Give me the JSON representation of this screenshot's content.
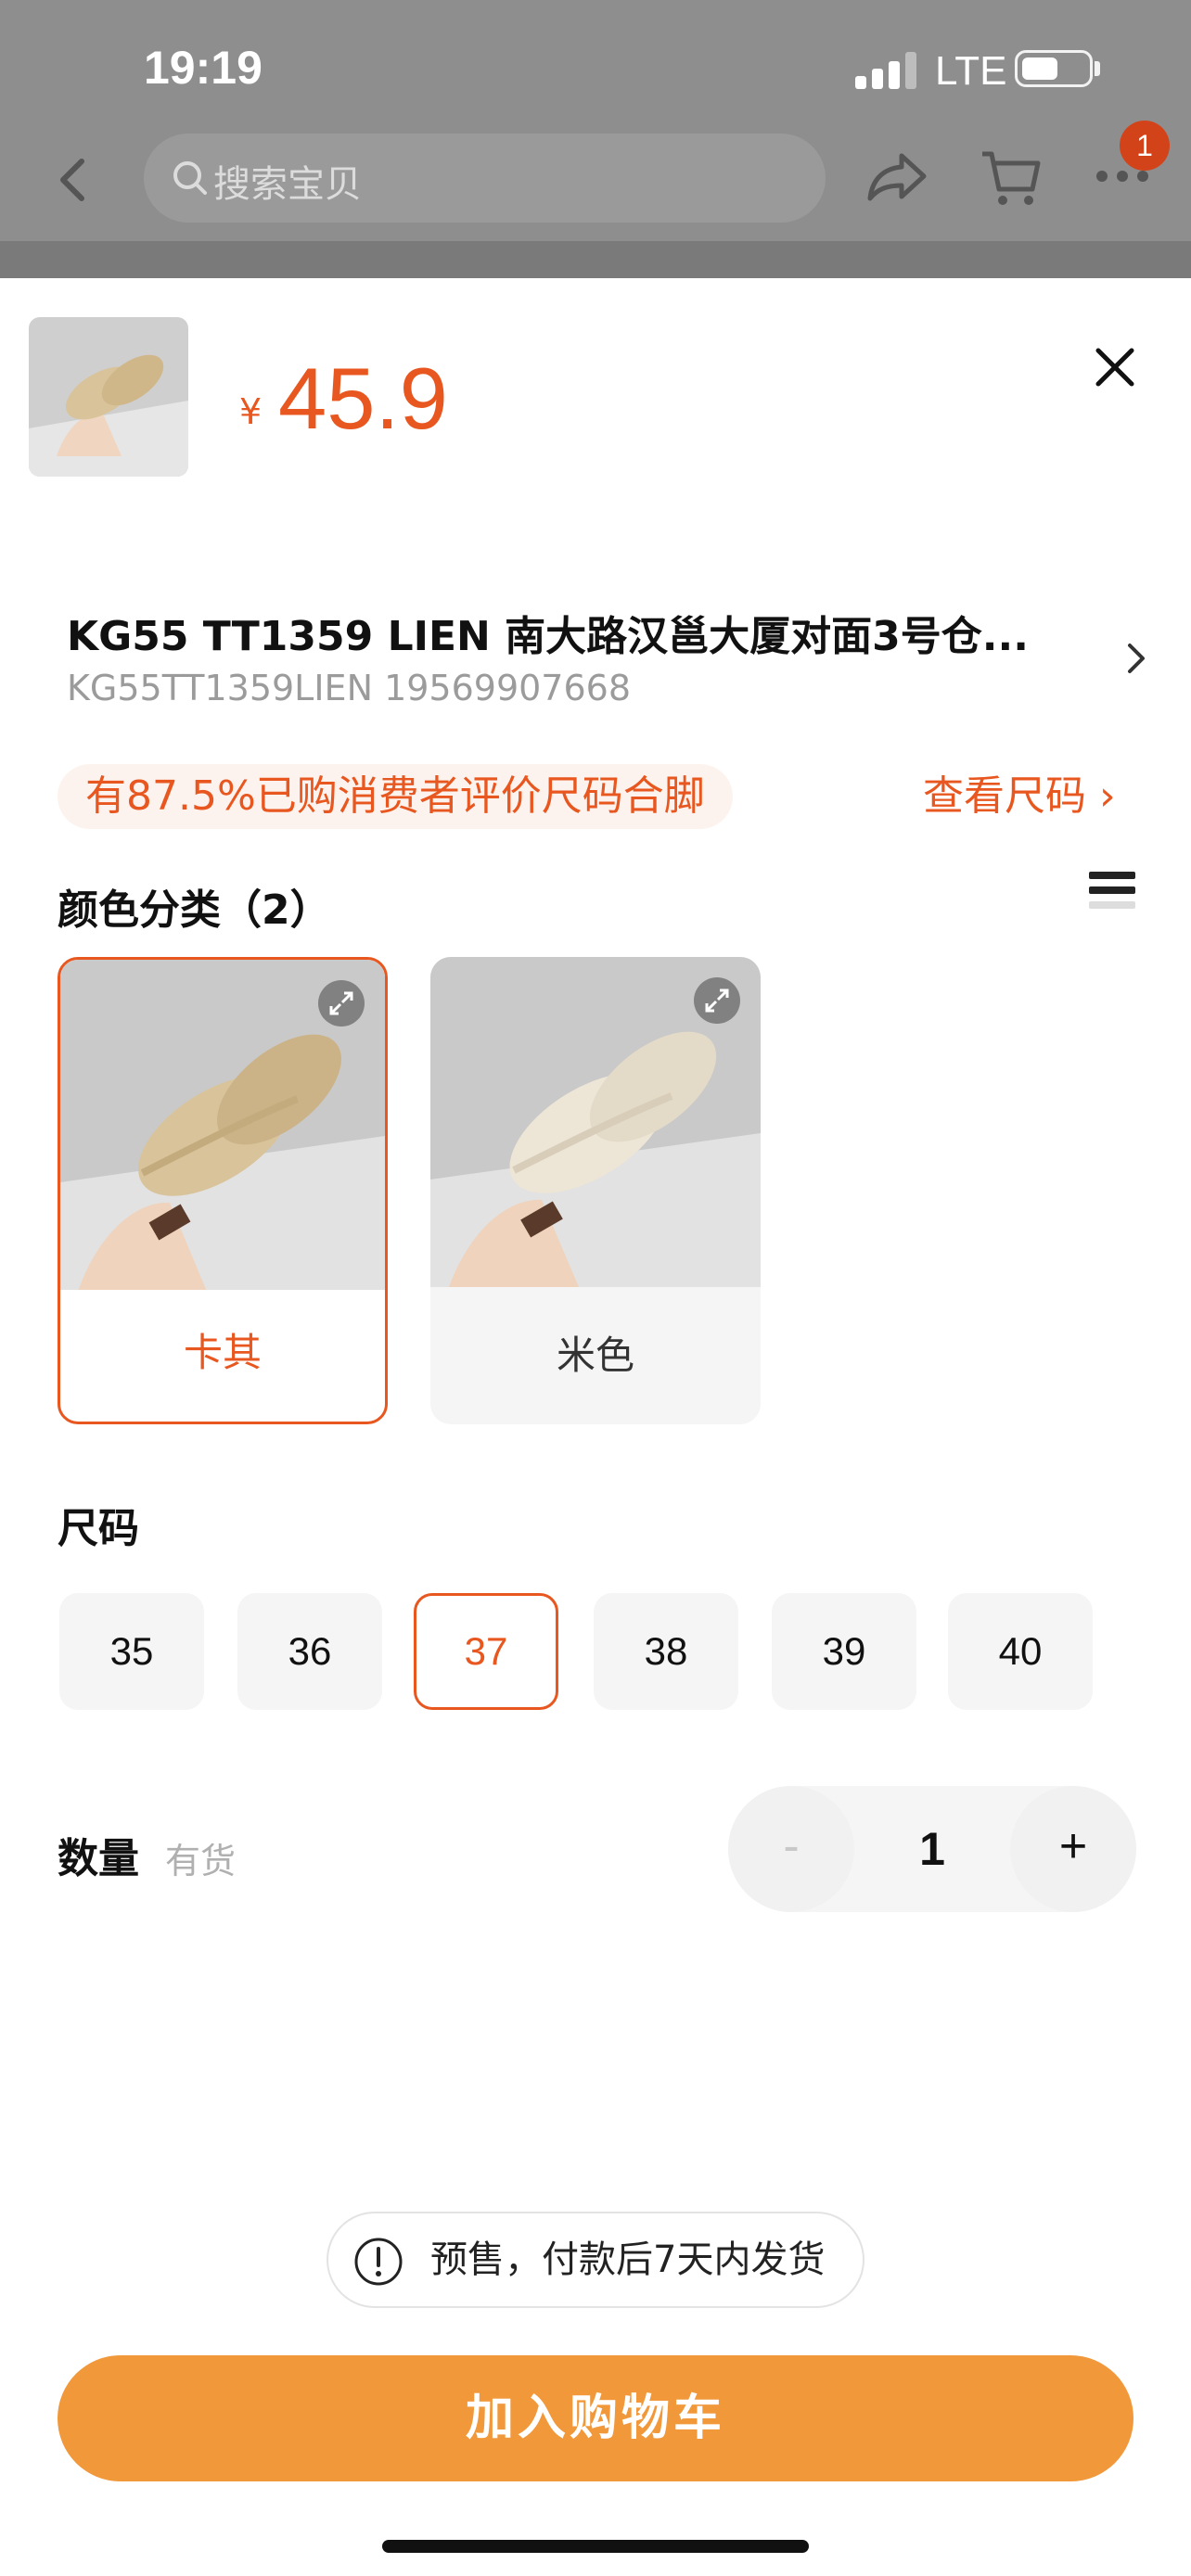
{
  "status_bar": {
    "time": "19:19",
    "network": "LTE"
  },
  "nav": {
    "search_placeholder": "搜索宝贝",
    "notification_count": "1"
  },
  "sku_sheet": {
    "currency_symbol": "¥",
    "price": "45.9",
    "store_name": "KG55 TT1359 LIEN  南大路汉邕大厦对面3号仓...",
    "store_code": "KG55TT1359LIEN 19569907668",
    "fit_tip": "有87.5%已购消费者评价尺码合脚",
    "size_link": "查看尺码 ›",
    "color_section_title": "颜色分类（2）",
    "colors": [
      {
        "label": "卡其",
        "selected": true,
        "shoe_color": "#d9c39a"
      },
      {
        "label": "米色",
        "selected": false,
        "shoe_color": "#ede5d6"
      }
    ],
    "size_section_title": "尺码",
    "sizes": [
      {
        "label": "35",
        "selected": false
      },
      {
        "label": "36",
        "selected": false
      },
      {
        "label": "37",
        "selected": true
      },
      {
        "label": "38",
        "selected": false
      },
      {
        "label": "39",
        "selected": false
      },
      {
        "label": "40",
        "selected": false
      }
    ],
    "quantity_label": "数量",
    "stock_status": "有货",
    "quantity": {
      "minus": "-",
      "value": "1",
      "plus": "+"
    },
    "presale_notice": "预售，付款后7天内发货",
    "add_to_cart_label": "加入购物车"
  },
  "colors": {
    "accent": "#e8571f",
    "button": "#f0983a"
  }
}
